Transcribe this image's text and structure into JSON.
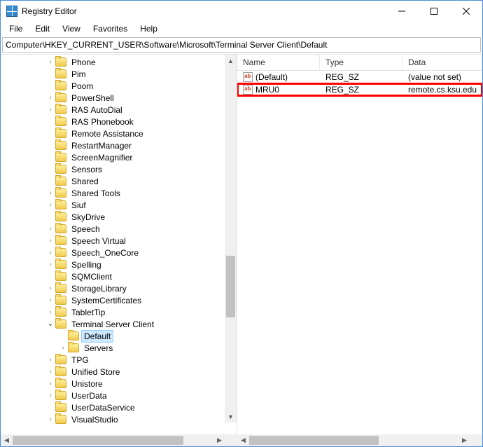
{
  "window": {
    "title": "Registry Editor"
  },
  "menu": {
    "file": "File",
    "edit": "Edit",
    "view": "View",
    "favorites": "Favorites",
    "help": "Help"
  },
  "address": {
    "path": "Computer\\HKEY_CURRENT_USER\\Software\\Microsoft\\Terminal Server Client\\Default"
  },
  "tree": {
    "items": [
      {
        "label": "Phone",
        "expand": "closed",
        "indent": 64
      },
      {
        "label": "Pim",
        "expand": "none",
        "indent": 64
      },
      {
        "label": "Poom",
        "expand": "none",
        "indent": 64
      },
      {
        "label": "PowerShell",
        "expand": "closed",
        "indent": 64
      },
      {
        "label": "RAS AutoDial",
        "expand": "closed",
        "indent": 64
      },
      {
        "label": "RAS Phonebook",
        "expand": "none",
        "indent": 64
      },
      {
        "label": "Remote Assistance",
        "expand": "none",
        "indent": 64
      },
      {
        "label": "RestartManager",
        "expand": "none",
        "indent": 64
      },
      {
        "label": "ScreenMagnifier",
        "expand": "none",
        "indent": 64
      },
      {
        "label": "Sensors",
        "expand": "none",
        "indent": 64
      },
      {
        "label": "Shared",
        "expand": "none",
        "indent": 64
      },
      {
        "label": "Shared Tools",
        "expand": "closed",
        "indent": 64
      },
      {
        "label": "Siuf",
        "expand": "closed",
        "indent": 64
      },
      {
        "label": "SkyDrive",
        "expand": "none",
        "indent": 64
      },
      {
        "label": "Speech",
        "expand": "closed",
        "indent": 64
      },
      {
        "label": "Speech Virtual",
        "expand": "closed",
        "indent": 64
      },
      {
        "label": "Speech_OneCore",
        "expand": "closed",
        "indent": 64
      },
      {
        "label": "Spelling",
        "expand": "closed",
        "indent": 64
      },
      {
        "label": "SQMClient",
        "expand": "none",
        "indent": 64
      },
      {
        "label": "StorageLibrary",
        "expand": "closed",
        "indent": 64
      },
      {
        "label": "SystemCertificates",
        "expand": "closed",
        "indent": 64
      },
      {
        "label": "TabletTip",
        "expand": "closed",
        "indent": 64
      },
      {
        "label": "Terminal Server Client",
        "expand": "open",
        "indent": 64
      },
      {
        "label": "Default",
        "expand": "none",
        "indent": 82,
        "selected": true
      },
      {
        "label": "Servers",
        "expand": "closed",
        "indent": 82
      },
      {
        "label": "TPG",
        "expand": "closed",
        "indent": 64
      },
      {
        "label": "Unified Store",
        "expand": "closed",
        "indent": 64
      },
      {
        "label": "Unistore",
        "expand": "closed",
        "indent": 64
      },
      {
        "label": "UserData",
        "expand": "closed",
        "indent": 64
      },
      {
        "label": "UserDataService",
        "expand": "none",
        "indent": 64
      },
      {
        "label": "VisualStudio",
        "expand": "closed",
        "indent": 64
      }
    ]
  },
  "list": {
    "columns": {
      "name": "Name",
      "type": "Type",
      "data": "Data"
    },
    "rows": [
      {
        "name": "(Default)",
        "type": "REG_SZ",
        "data": "(value not set)",
        "highlight": false
      },
      {
        "name": "MRU0",
        "type": "REG_SZ",
        "data": "remote.cs.ksu.edu",
        "highlight": true
      }
    ]
  }
}
